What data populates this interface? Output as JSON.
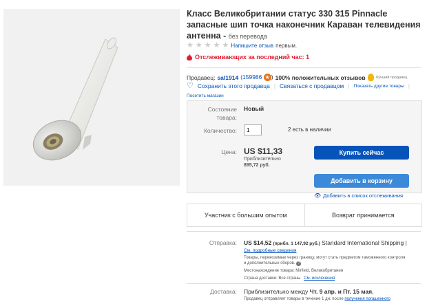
{
  "listing": {
    "title": "Класс Великобритании статус 330 315 Pinnacle запасные шип точка наконечник Караван телевидения антенна -",
    "title_note": "без перевода",
    "rating_link": "Напишите отзыв",
    "rating_suffix": "первым.",
    "watchers": "Отслеживающих за последний час: 1"
  },
  "seller": {
    "label": "Продавец:",
    "name": "sal1914",
    "feedback_count": "(159986",
    "feedback_close": ")",
    "positive": "100% положительных отзывов",
    "top_badge": "Лучший продавец",
    "save_link": "Сохранить этого продавца",
    "contact_link": "Связаться с продавцом",
    "other_items": "Показать другие товары",
    "visit_store": "Посетить магазин"
  },
  "buy_box": {
    "condition_label": "Состояние товара:",
    "condition_value": "Новый",
    "quantity_label": "Количество:",
    "quantity_value": "1",
    "available": "2 есть в наличии",
    "price_label": "Цена:",
    "price": "US $11,33",
    "approx_label": "Приблизительно",
    "approx_value": "895,72 руб.",
    "buy_now": "Купить сейчас",
    "add_cart": "Добавить в корзину",
    "watch": "Добавить в список отслеживания"
  },
  "badges": {
    "left": "Участник с большим опытом",
    "right": "Возврат принимается"
  },
  "shipping": {
    "label": "Отправка:",
    "price": "US $14,52",
    "approx": "(прибл. 1 147,92 руб.)",
    "service": "Standard International Shipping |",
    "details_link": "См. подробные сведения",
    "note1": "Товары, перевозимые через границу, могут стать предметом таможенного контроля",
    "note2": "и дополнительных сборов.",
    "location": "Местонахождение товара: Mirfield, Великобритания",
    "countries": "Страна доставки: Все страны",
    "exceptions_link": "См. исключения"
  },
  "delivery": {
    "label": "Доставка:",
    "approx": "Приблизительно между",
    "dates": "Чт. 9 апр. и Пт. 15 мая.",
    "note": "Продавец отправляет товары в течение 1 дн. после",
    "note_link": "получения погашенного"
  },
  "colors": {
    "primary_button": "#0654ba",
    "secondary_button": "#3b8ad9",
    "alert": "#dd1e31",
    "link": "#0654ba"
  }
}
